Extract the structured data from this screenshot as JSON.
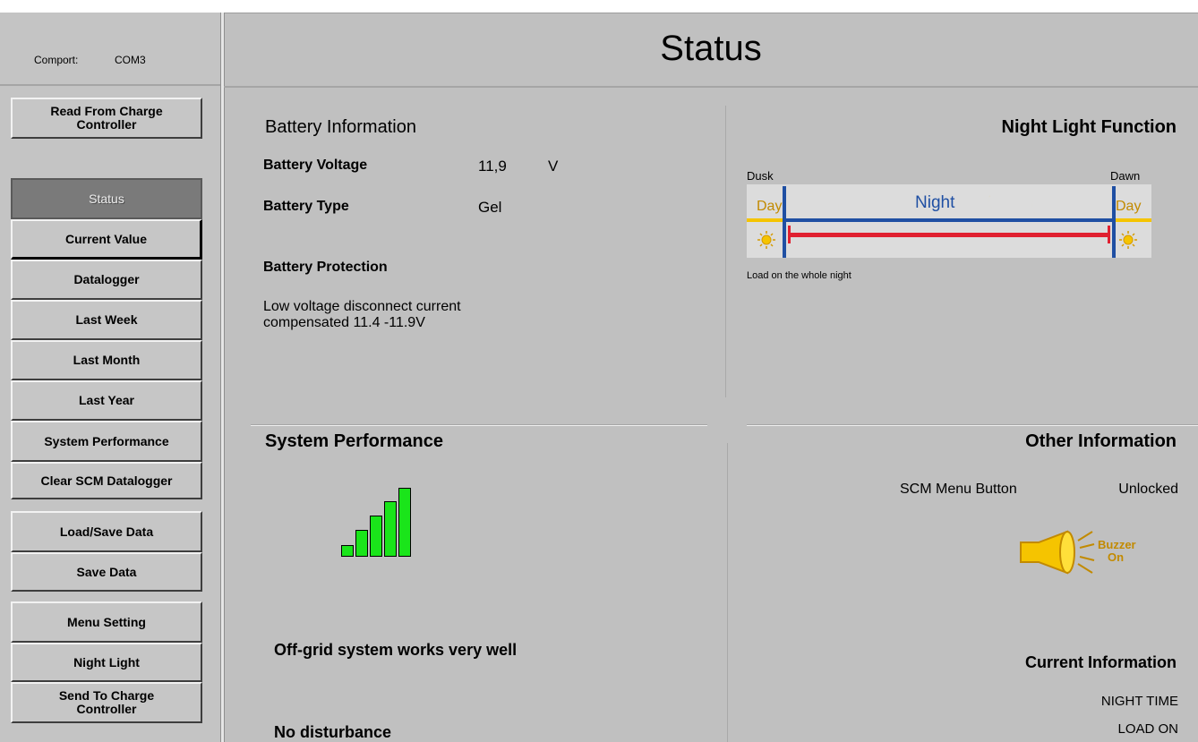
{
  "comport": {
    "label": "Comport:",
    "value": "COM3"
  },
  "header": {
    "title": "Status"
  },
  "sidebar": {
    "read_button": [
      "Read From Charge",
      "Controller"
    ],
    "items": [
      {
        "label": "Status"
      },
      {
        "label": "Current Value"
      },
      {
        "label": "Datalogger"
      },
      {
        "label": "Last Week"
      },
      {
        "label": "Last Month"
      },
      {
        "label": "Last Year"
      },
      {
        "label": "System Performance"
      },
      {
        "label": "Clear SCM Datalogger"
      },
      {
        "label": "Load/Save Data"
      },
      {
        "label": "Save Data"
      },
      {
        "label": "Menu Setting"
      },
      {
        "label": "Night Light"
      }
    ],
    "send_button": [
      "Send To Charge",
      "Controller"
    ]
  },
  "battery": {
    "title": "Battery Information",
    "voltage_label": "Battery Voltage",
    "voltage_value": "11,9",
    "voltage_unit": "V",
    "type_label": "Battery Type",
    "type_value": "Gel",
    "protection_label": "Battery Protection",
    "protection_text": [
      "Low voltage disconnect current",
      "compensated 11.4 -11.9V"
    ]
  },
  "night_light": {
    "title": "Night Light Function",
    "dusk": "Dusk",
    "dawn": "Dawn",
    "day_left": "Day",
    "night": "Night",
    "day_right": "Day",
    "caption": "Load on the whole night"
  },
  "performance": {
    "title": "System Performance",
    "signal_level": 5,
    "signal_max": 5,
    "status_text": "Off-grid system works very well",
    "disturbance_text": "No disturbance"
  },
  "other": {
    "title": "Other Information",
    "menu_button_label": "SCM Menu Button",
    "menu_button_value": "Unlocked",
    "buzzer_text": [
      "Buzzer",
      "On"
    ],
    "current_title": "Current Information",
    "current_lines": [
      "NIGHT TIME",
      "LOAD ON"
    ]
  },
  "colors": {
    "background": "#c0c0c0",
    "signal_green": "#1ae51a",
    "night_blue": "#1f4fa3",
    "load_red": "#e02030",
    "day_yellow": "#f5c400"
  }
}
